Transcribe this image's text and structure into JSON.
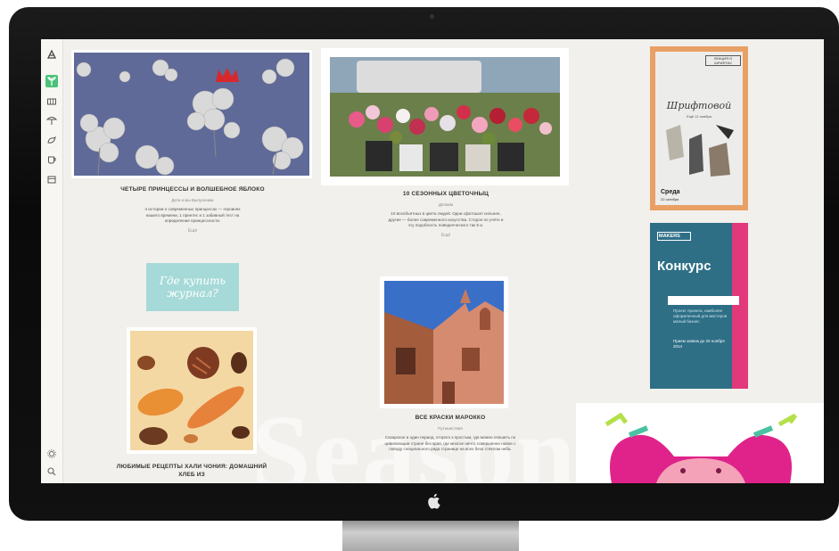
{
  "device": {
    "logo_icon": "apple-icon"
  },
  "sidebar": {
    "items": [
      {
        "icon": "logo-icon"
      },
      {
        "icon": "leaf-icon",
        "active": true
      },
      {
        "icon": "map-icon"
      },
      {
        "icon": "fan-icon"
      },
      {
        "icon": "bird-icon"
      },
      {
        "icon": "cup-icon"
      },
      {
        "icon": "box-icon"
      }
    ],
    "bottom": [
      {
        "icon": "gear-icon"
      },
      {
        "icon": "search-icon"
      }
    ]
  },
  "feed": {
    "watermark": "Season",
    "col1": {
      "article1": {
        "title": "ЧЕТЫРЕ ПРИНЦЕССЫ И ВОЛШЕБНОЕ ЯБЛОКО",
        "meta": "Дети и мы Выпускники",
        "text": "4 истории о современных принцессах — героинях нашего времени, 1 принтес и 1 забавный тест на определение принцессности.",
        "more": "Ещё"
      },
      "promo": {
        "label": "Где купить журнал?"
      },
      "article2": {
        "title": "ЛЮБИМЫЕ РЕЦЕПТЫ ХАЛИ ЧОНИЯ: ДОМАШНИЙ ХЛЕБ ИЗ"
      }
    },
    "col2": {
      "article1": {
        "title": "10 СЕЗОННЫХ ЦВЕТОЧНЫЦ",
        "meta": "Делаем",
        "text": "10 всеобъятных в цвета людей. Одни сфотошоп сильнее, другие — более современного искусства. Сторон по учёте и эту подобность поведенческого так 5 и.",
        "more": "Ещё"
      },
      "article2": {
        "title": "ВСЕ КРАСКИ МАРОККО",
        "meta": "Путешествия",
        "text": "Сахарское и один период, оторого к простым, где можно спешить по цивилизации стране без края, где многое ничто совершенно новое с поводу специального ряда странице на всех безо стёклом неба."
      }
    },
    "col3": {
      "poster1": {
        "header": "ЛЕКЦИЯ О ШРИФТАХ",
        "script": "Шрифтовой",
        "note": "Ещё 11 ноября",
        "footer": "Среда",
        "date": "22 октября"
      },
      "poster2": {
        "brand": "MAKERS",
        "title": "Конкурс",
        "text": "Проект проекта, наиболее оформленный для мастеров малый бизнес",
        "deadline": "Прием заявок до 20 ноября 2014"
      }
    }
  },
  "colors": {
    "screen_bg": "#f2f0ec",
    "accent_green": "#4cc17a",
    "promo_mint": "#a6dad8",
    "poster_orange": "#e8a065",
    "poster_teal": "#2e6f86",
    "poster_pink": "#e2397a"
  }
}
